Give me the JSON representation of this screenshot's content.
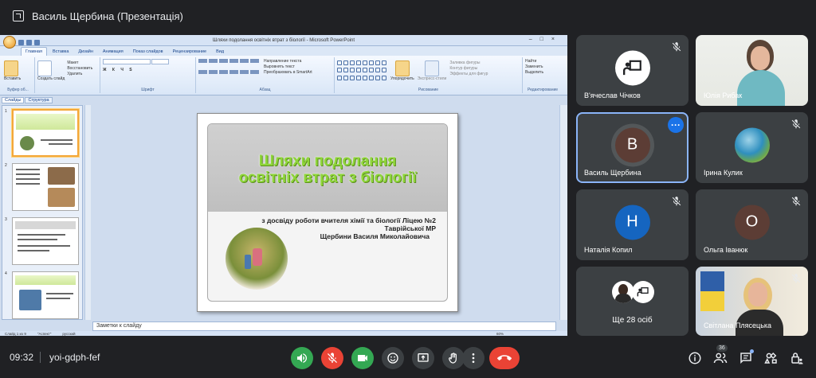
{
  "header": {
    "title": "Василь Щербина (Презентація)"
  },
  "powerpoint": {
    "window_title": "Шляхи подолання освітніх втрат з біології - Microsoft PowerPoint",
    "tabs": [
      "Главная",
      "Вставка",
      "Дизайн",
      "Анимация",
      "Показ слайдов",
      "Рецензирование",
      "Вид"
    ],
    "groups": {
      "clipboard": {
        "label": "Буфер об...",
        "paste": "Вставить",
        "items": [
          "Макет",
          "Восстановить",
          "Удалить"
        ],
        "create": "Создать слайд"
      },
      "font": {
        "label": "Шрифт"
      },
      "paragraph": {
        "label": "Абзац",
        "items": [
          "Направление текста",
          "Выровнять текст",
          "Преобразовать в SmartArt"
        ]
      },
      "drawing": {
        "label": "Рисование",
        "arrange": "Упорядочить",
        "styles": "Экспресс-стили",
        "items": [
          "Заливка фигуры",
          "Контур фигуры",
          "Эффекты для фигур"
        ]
      },
      "editing": {
        "label": "Редактирование",
        "items": [
          "Найти",
          "Заменить",
          "Выделить"
        ]
      }
    },
    "panel_tabs": [
      "Слайды",
      "Структура"
    ],
    "slide_numbers": [
      "1",
      "2",
      "3",
      "4"
    ],
    "slide": {
      "title_line1": "Шляхи подолання",
      "title_line2": "освітніх втрат з біології",
      "subtitle_line1": "з досвіду роботи вчителя хімії та біології Ліцею №2",
      "subtitle_line2": "Таврійської МР",
      "subtitle_line3": "Щербини Василя Миколайовича"
    },
    "notes_placeholder": "Заметки к слайду",
    "status": {
      "slide": "Слайд 1 из 9",
      "theme": "\"Аспект\"",
      "language": "русский",
      "zoom": "60%"
    }
  },
  "participants": [
    {
      "name": "В'ячеслав Чічков",
      "type": "icon",
      "muted": true
    },
    {
      "name": "Юлія Рибак",
      "type": "video",
      "muted": false
    },
    {
      "name": "Василь Щербина",
      "type": "avatar",
      "initial": "В",
      "color": "#5c3d35",
      "muted": false,
      "active": true
    },
    {
      "name": "Ірина Кулик",
      "type": "photo",
      "muted": true
    },
    {
      "name": "Наталія Копил",
      "type": "avatar",
      "initial": "Н",
      "color": "#1565c0",
      "muted": true
    },
    {
      "name": "Ольга Іванюк",
      "type": "avatar",
      "initial": "О",
      "color": "#5c3d35",
      "muted": true
    },
    {
      "name": "Ще 28 осіб",
      "type": "more",
      "muted": false
    },
    {
      "name": "Світлана Плясецька",
      "type": "video",
      "muted": true
    }
  ],
  "bottom": {
    "time": "09:32",
    "meeting_code": "yoi-gdph-fef",
    "people_count": "36"
  },
  "colors": {
    "bg": "#202124",
    "tile": "#3c4043",
    "mic_off": "#ea4335",
    "camera_on": "#34a853",
    "accent": "#8ab4f8"
  }
}
